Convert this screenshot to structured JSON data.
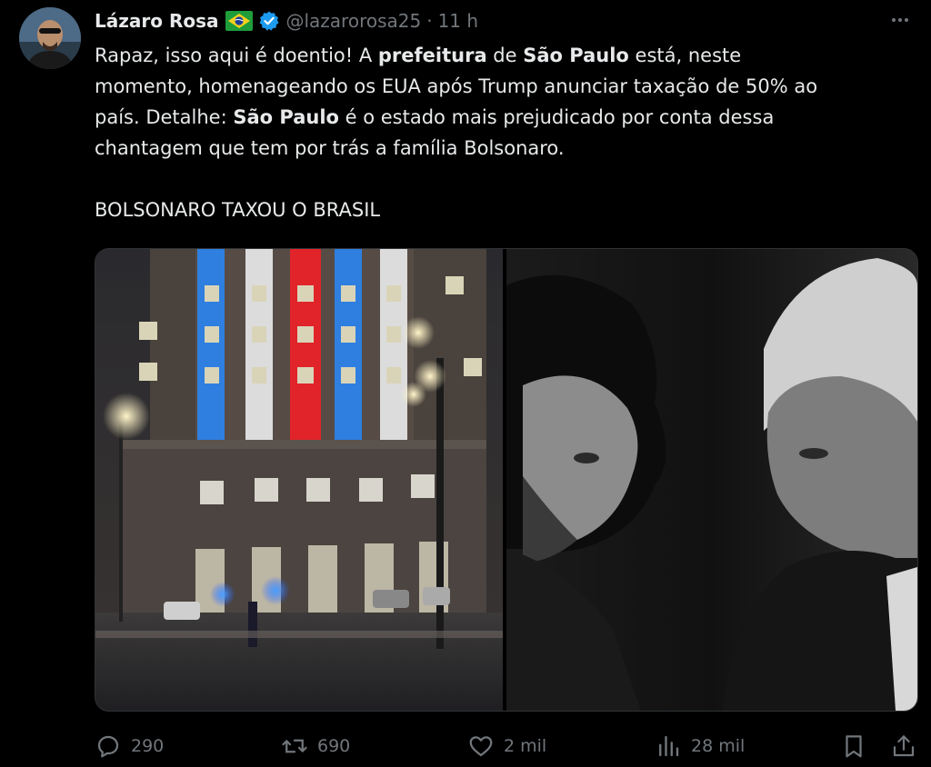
{
  "author": {
    "name": "Lázaro Rosa",
    "handle": "@lazarorosa25",
    "separator": "·",
    "time": "11 h",
    "flag_icon": "brazil-flag-icon",
    "verified_icon": "verified-badge-icon"
  },
  "tweet": {
    "line1_a": "Rapaz, isso aqui é doentio! A ",
    "line1_b": "prefeitura",
    "line1_c": " de ",
    "line1_d": "São Paulo",
    "line1_e": " está, neste",
    "line2": "momento, homenageando os EUA após Trump anunciar taxação de 50% ao",
    "line3_a": "país. Detalhe: ",
    "line3_b": "São Paulo",
    "line3_c": " é o estado mais prejudicado por conta dessa",
    "line4": "chantagem que tem por trás a família Bolsonaro.",
    "line5": "BOLSONARO TAXOU O BRASIL"
  },
  "media": {
    "left_image": "building-lit-red-white-blue-at-night",
    "right_image": "two-men-black-and-white-portrait"
  },
  "actions": {
    "replies": "290",
    "reposts": "690",
    "likes": "2 mil",
    "views": "28 mil"
  },
  "colors": {
    "background": "#000000",
    "text": "#e7e9ea",
    "muted": "#71767b",
    "verified": "#1d9bf0"
  }
}
